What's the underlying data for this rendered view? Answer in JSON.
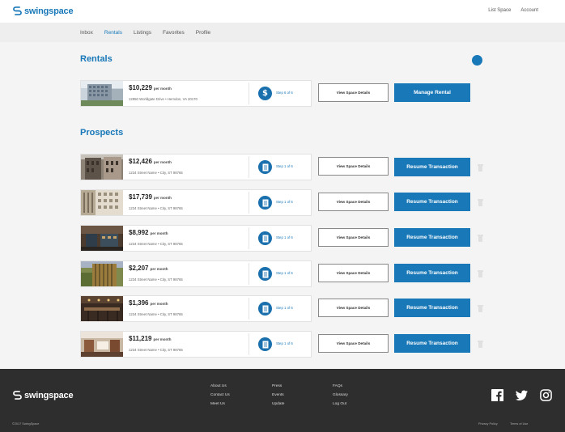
{
  "header": {
    "brand": "swingspace",
    "links": [
      "List Space",
      "Account"
    ]
  },
  "nav": {
    "tabs": [
      {
        "label": "Inbox",
        "active": false
      },
      {
        "label": "Rentals",
        "active": true
      },
      {
        "label": "Listings",
        "active": false
      },
      {
        "label": "Favorites",
        "active": false
      },
      {
        "label": "Profile",
        "active": false
      }
    ]
  },
  "rentals": {
    "title": "Rentals",
    "items": [
      {
        "price": "$10,229",
        "per": "per month",
        "address": "12950 Worldgate Drive • Herndon, VA 20170",
        "step": "Step 6 of 6",
        "details_label": "View Space Details",
        "action_label": "Manage Rental"
      }
    ]
  },
  "prospects": {
    "title": "Prospects",
    "items": [
      {
        "price": "$12,426",
        "per": "per month",
        "address": "1234 Street Name • City, ST 98765",
        "step": "Step 1 of 6",
        "details_label": "View Space Details",
        "action_label": "Resume Transaction"
      },
      {
        "price": "$17,739",
        "per": "per month",
        "address": "1234 Street Name • City, ST 98765",
        "step": "Step 1 of 6",
        "details_label": "View Space Details",
        "action_label": "Resume Transaction"
      },
      {
        "price": "$8,992",
        "per": "per month",
        "address": "1234 Street Name • City, ST 98765",
        "step": "Step 1 of 6",
        "details_label": "View Space Details",
        "action_label": "Resume Transaction"
      },
      {
        "price": "$2,207",
        "per": "per month",
        "address": "1234 Street Name • City, ST 98765",
        "step": "Step 1 of 6",
        "details_label": "View Space Details",
        "action_label": "Resume Transaction"
      },
      {
        "price": "$1,396",
        "per": "per month",
        "address": "1234 Street Name • City, ST 98765",
        "step": "Step 1 of 6",
        "details_label": "View Space Details",
        "action_label": "Resume Transaction"
      },
      {
        "price": "$11,219",
        "per": "per month",
        "address": "1234 Street Name • City, ST 98765",
        "step": "Step 1 of 6",
        "details_label": "View Space Details",
        "action_label": "Resume Transaction"
      }
    ]
  },
  "footer": {
    "brand": "swingspace",
    "col1": [
      "About Us",
      "Contact Us",
      "Meet Us"
    ],
    "col2": [
      "Press",
      "Events",
      "Update"
    ],
    "col3": [
      "FAQs",
      "Glossary",
      "Log Out"
    ],
    "social": [
      "facebook-icon",
      "twitter-icon",
      "instagram-icon"
    ],
    "copyright": "©2017 SwingSpace",
    "legal": [
      "Privacy Policy",
      "Terms of Use"
    ]
  },
  "colors": {
    "brand": "#1878b8",
    "footer_bg": "#2e2e2e",
    "page_bg": "#f4f4f4"
  }
}
